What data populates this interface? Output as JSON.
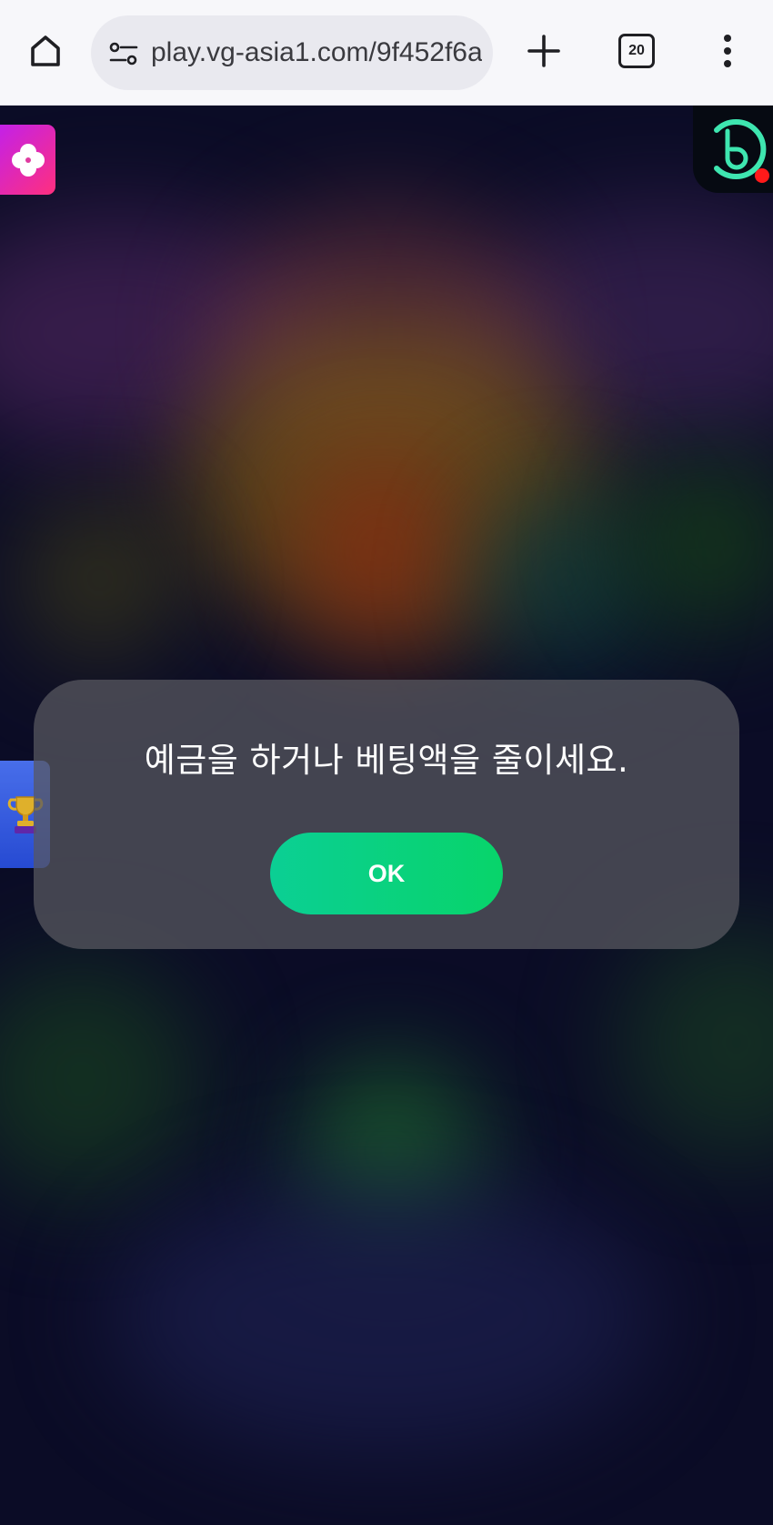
{
  "browser": {
    "url": "play.vg-asia1.com/9f452f6a",
    "tab_count": "20",
    "icons": {
      "home": "home-icon",
      "site_info": "site-settings-icon",
      "new_tab": "plus-icon",
      "tabs": "tab-switcher-icon",
      "menu": "more-vert-icon"
    }
  },
  "game": {
    "icons": {
      "left_badge": "clover-icon",
      "corner_logo": "replay-logo-icon",
      "side_tab": "trophy-icon"
    },
    "colors": {
      "ok_button_start": "#0bcf94",
      "ok_button_end": "#08d46a",
      "notification_dot": "#ff1a1a"
    }
  },
  "dialog": {
    "message": "예금을 하거나 베팅액을 줄이세요.",
    "ok_label": "OK"
  }
}
